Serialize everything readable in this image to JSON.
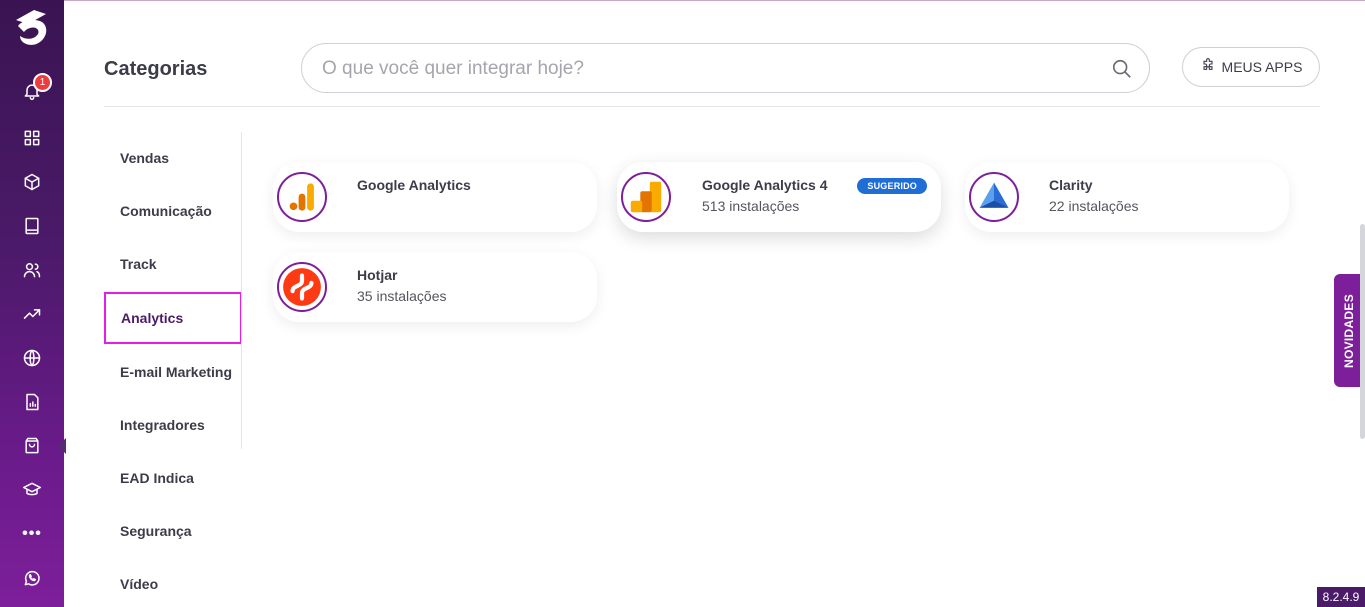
{
  "header": {
    "title": "Categorias",
    "search_placeholder": "O que você quer integrar hoje?",
    "my_apps_label": "MEUS APPS"
  },
  "sidebar": {
    "notification_count": "1",
    "more_label": "•••",
    "items": [
      {
        "icon": "bell-icon"
      },
      {
        "icon": "grid-icon"
      },
      {
        "icon": "cube-icon"
      },
      {
        "icon": "book-icon"
      },
      {
        "icon": "users-icon"
      },
      {
        "icon": "trending-up-icon"
      },
      {
        "icon": "globe-icon"
      },
      {
        "icon": "report-icon"
      },
      {
        "icon": "shopping-bag-icon",
        "active": true
      },
      {
        "icon": "graduation-cap-icon"
      },
      {
        "icon": "more-icon"
      },
      {
        "icon": "whatsapp-icon"
      }
    ]
  },
  "categories": [
    {
      "label": "Vendas"
    },
    {
      "label": "Comunicação"
    },
    {
      "label": "Track"
    },
    {
      "label": "Analytics",
      "active": true
    },
    {
      "label": "E-mail Marketing"
    },
    {
      "label": "Integradores"
    },
    {
      "label": "EAD Indica"
    },
    {
      "label": "Segurança"
    },
    {
      "label": "Vídeo"
    }
  ],
  "apps": [
    {
      "name": "Google Analytics",
      "installs": "",
      "tag": ""
    },
    {
      "name": "Google Analytics 4",
      "installs": "513 instalações",
      "tag": "SUGERIDO"
    },
    {
      "name": "Clarity",
      "installs": "22 instalações",
      "tag": ""
    },
    {
      "name": "Hotjar",
      "installs": "35 instalações",
      "tag": ""
    }
  ],
  "novidades_label": "NOVIDADES",
  "version": "8.2.4.9",
  "colors": {
    "brand_purple": "#4b1a69",
    "accent_purple": "#7d1f9a",
    "active_outline": "#e31ee8",
    "tag_blue": "#1f6ed6",
    "badge_red": "#ee3b3b"
  }
}
